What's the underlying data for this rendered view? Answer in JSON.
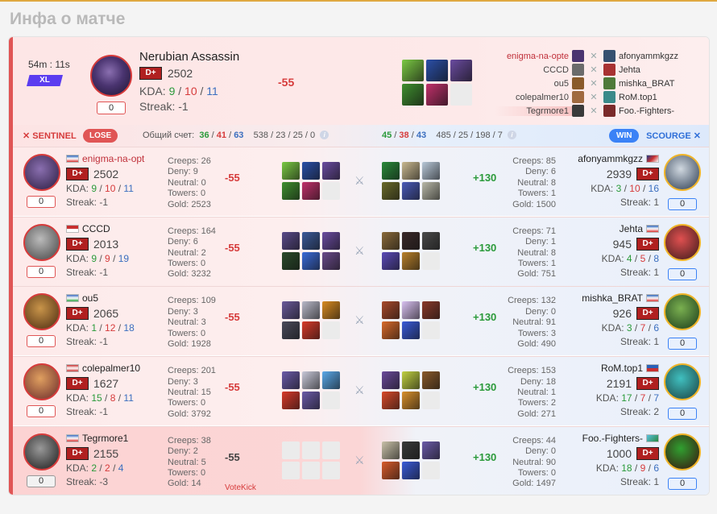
{
  "page_title": "Инфа о матче",
  "summary": {
    "duration": "54m : 11s",
    "mode": "XL",
    "hero": "Nerubian Assassin",
    "rank": "D+",
    "rating": "2502",
    "kda_label": "KDA:",
    "kills": "9",
    "deaths": "10",
    "assists": "11",
    "streak": "Streak: -1",
    "chip": "0",
    "delta": "-55",
    "item_colors": [
      "#7ac943",
      "#2b4fa8",
      "#6a4ba0",
      "#3f8f2f",
      "#c0306a",
      ""
    ]
  },
  "lineup": [
    {
      "left": "enigma-na-opte",
      "left_color": "#4a3470",
      "right": "afonyammkgzz",
      "right_color": "#355070"
    },
    {
      "left": "CCCD",
      "left_color": "#6b6b6b",
      "right": "Jehta",
      "right_color": "#a83232"
    },
    {
      "left": "ou5",
      "left_color": "#8a5a2a",
      "right": "mishka_BRAT",
      "right_color": "#4e7a3a"
    },
    {
      "left": "colepalmer10",
      "left_color": "#a06a40",
      "right": "RoM.top1",
      "right_color": "#3a8a8a"
    },
    {
      "left": "Tegrmore1",
      "left_color": "#3a3a3a",
      "right": "Foo.-Fighters-",
      "right_color": "#7a2a2a"
    }
  ],
  "header": {
    "sentinel": "SENTINEL",
    "lose": "LOSE",
    "score_label": "Общий счет:",
    "l_k": "36",
    "l_d": "41",
    "l_a": "63",
    "l_totals": "538 / 23 / 25 / 0",
    "r_k": "45",
    "r_d": "38",
    "r_a": "43",
    "r_totals": "485 / 25 / 198 / 7",
    "win": "WIN",
    "scourge": "SCOURGE"
  },
  "rows": [
    {
      "l_name": "enigma-na-opte",
      "l_rank": "D+",
      "l_rating": "2502",
      "l_k": "9",
      "l_d": "10",
      "l_a": "11",
      "l_streak": "Streak: -1",
      "l_chip": "0",
      "l_creeps": "Creeps: 26",
      "l_deny": "Deny: 9",
      "l_neutral": "Neutral: 0",
      "l_towers": "Towers: 0",
      "l_gold": "Gold: 2523",
      "l_delta": "-55",
      "l_votekick": "",
      "r_delta": "+130",
      "r_creeps": "Creeps: 85",
      "r_deny": "Deny: 6",
      "r_neutral": "Neutral: 8",
      "r_towers": "Towers: 1",
      "r_gold": "Gold: 1500",
      "r_name": "afonyammkgzz",
      "r_rank": "D+",
      "r_rating": "2939",
      "r_k": "3",
      "r_d": "10",
      "r_a": "16",
      "r_streak": "Streak: 1",
      "r_chip": "0"
    },
    {
      "l_name": "CCCD",
      "l_rank": "D+",
      "l_rating": "2013",
      "l_k": "9",
      "l_d": "9",
      "l_a": "19",
      "l_streak": "Streak: -1",
      "l_chip": "0",
      "l_creeps": "Creeps: 164",
      "l_deny": "Deny: 6",
      "l_neutral": "Neutral: 2",
      "l_towers": "Towers: 0",
      "l_gold": "Gold: 3232",
      "l_delta": "-55",
      "l_votekick": "",
      "r_delta": "+130",
      "r_creeps": "Creeps: 71",
      "r_deny": "Deny: 1",
      "r_neutral": "Neutral: 8",
      "r_towers": "Towers: 1",
      "r_gold": "Gold: 751",
      "r_name": "Jehta",
      "r_rank": "D+",
      "r_rating": "945",
      "r_k": "4",
      "r_d": "5",
      "r_a": "8",
      "r_streak": "Streak: 1",
      "r_chip": "0"
    },
    {
      "l_name": "ou5",
      "l_rank": "D+",
      "l_rating": "2065",
      "l_k": "1",
      "l_d": "12",
      "l_a": "18",
      "l_streak": "Streak: -1",
      "l_chip": "0",
      "l_creeps": "Creeps: 109",
      "l_deny": "Deny: 3",
      "l_neutral": "Neutral: 3",
      "l_towers": "Towers: 0",
      "l_gold": "Gold: 1928",
      "l_delta": "-55",
      "l_votekick": "",
      "r_delta": "+130",
      "r_creeps": "Creeps: 132",
      "r_deny": "Deny: 0",
      "r_neutral": "Neutral: 91",
      "r_towers": "Towers: 3",
      "r_gold": "Gold: 490",
      "r_name": "mishka_BRAT",
      "r_rank": "D+",
      "r_rating": "926",
      "r_k": "3",
      "r_d": "7",
      "r_a": "6",
      "r_streak": "Streak: 1",
      "r_chip": "0"
    },
    {
      "l_name": "colepalmer10",
      "l_rank": "D+",
      "l_rating": "1627",
      "l_k": "15",
      "l_d": "8",
      "l_a": "11",
      "l_streak": "Streak: -1",
      "l_chip": "0",
      "l_creeps": "Creeps: 201",
      "l_deny": "Deny: 3",
      "l_neutral": "Neutral: 15",
      "l_towers": "Towers: 0",
      "l_gold": "Gold: 3792",
      "l_delta": "-55",
      "l_votekick": "",
      "r_delta": "+130",
      "r_creeps": "Creeps: 153",
      "r_deny": "Deny: 18",
      "r_neutral": "Neutral: 1",
      "r_towers": "Towers: 2",
      "r_gold": "Gold: 271",
      "r_name": "RoM.top1",
      "r_rank": "D+",
      "r_rating": "2191",
      "r_k": "17",
      "r_d": "7",
      "r_a": "7",
      "r_streak": "Streak: 2",
      "r_chip": "0"
    },
    {
      "l_name": "Tegrmore1",
      "l_rank": "D+",
      "l_rating": "2155",
      "l_k": "2",
      "l_d": "2",
      "l_a": "4",
      "l_streak": "Streak: -3",
      "l_chip": "0",
      "l_creeps": "Creeps: 38",
      "l_deny": "Deny: 2",
      "l_neutral": "Neutral: 5",
      "l_towers": "Towers: 0",
      "l_gold": "Gold: 14",
      "l_delta": "-55",
      "l_votekick": "VoteKick",
      "r_delta": "+130",
      "r_creeps": "Creeps: 44",
      "r_deny": "Deny: 0",
      "r_neutral": "Neutral: 90",
      "r_towers": "Towers: 0",
      "r_gold": "Gold: 1497",
      "r_name": "Foo.-Fighters-",
      "r_rank": "D+",
      "r_rating": "1000",
      "r_k": "18",
      "r_d": "9",
      "r_a": "6",
      "r_streak": "Streak: 1",
      "r_chip": "0"
    }
  ]
}
